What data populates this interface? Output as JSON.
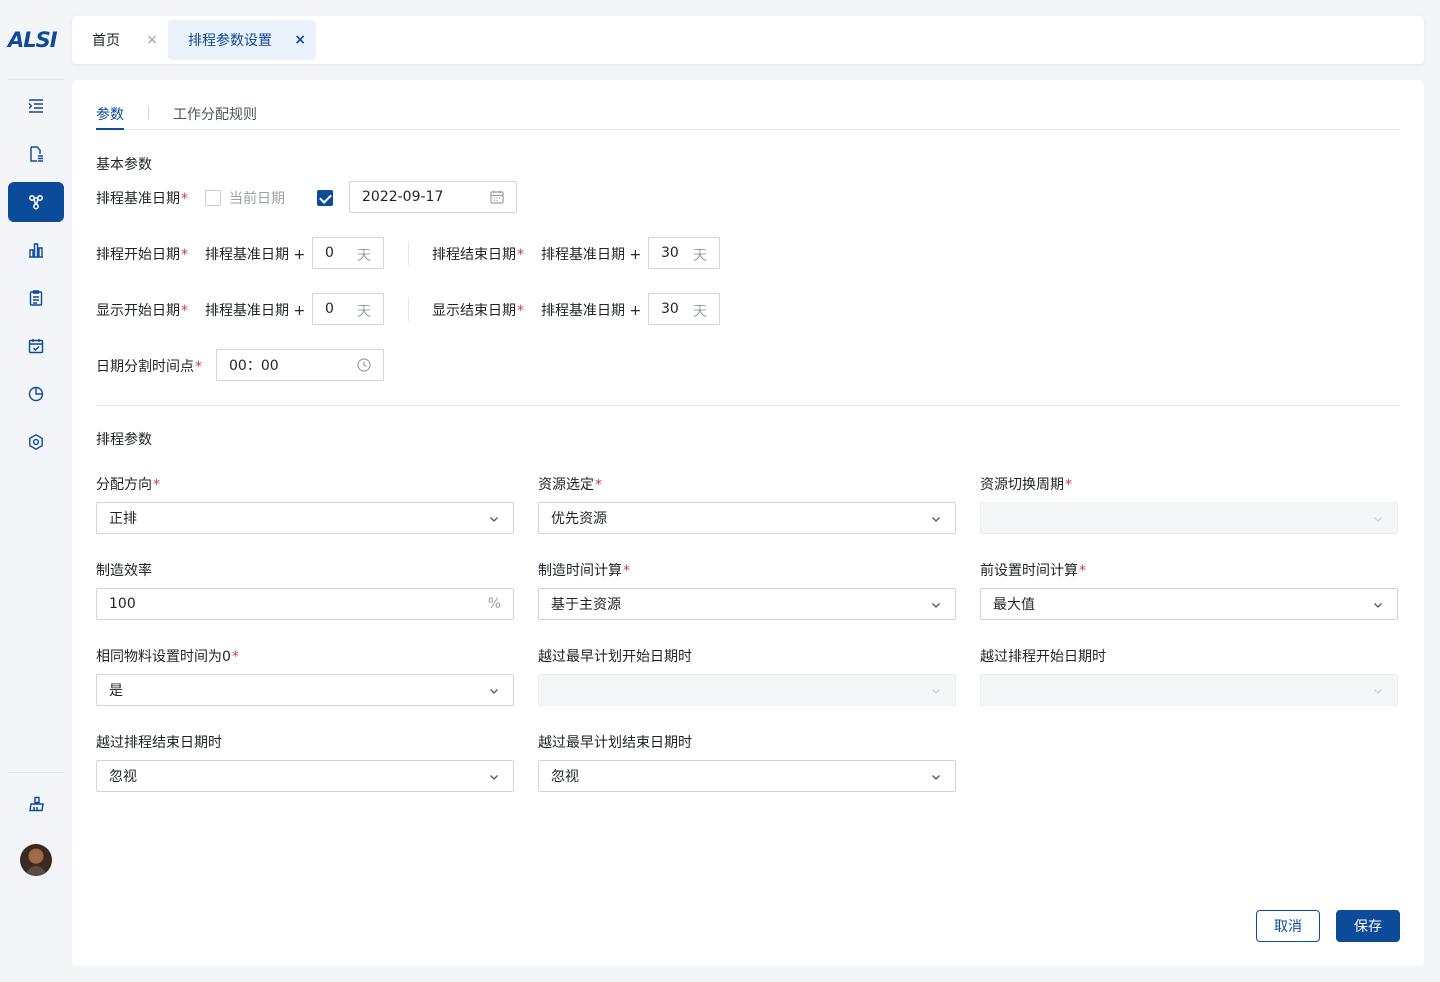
{
  "brand": {
    "logo_text": "ALSI",
    "accent_color": "#0c4a9a"
  },
  "sidebar": {
    "items": [
      {
        "icon": "menu-indent-icon"
      },
      {
        "icon": "document-list-icon"
      },
      {
        "icon": "schedule-flow-icon",
        "active": true
      },
      {
        "icon": "bar-chart-icon"
      },
      {
        "icon": "clipboard-icon"
      },
      {
        "icon": "calendar-check-icon"
      },
      {
        "icon": "pie-chart-icon"
      },
      {
        "icon": "settings-hexagon-icon"
      }
    ],
    "bottom": [
      {
        "icon": "clean-icon"
      },
      {
        "icon": "user-avatar"
      }
    ]
  },
  "page_tabs": [
    {
      "label": "首页",
      "close": "×"
    },
    {
      "label": "排程参数设置",
      "close": "×",
      "active": true
    }
  ],
  "sub_tabs": {
    "params": "参数",
    "rules": "工作分配规则"
  },
  "basic": {
    "title": "基本参数",
    "base_date_label": "排程基准日期",
    "current_date_label": "当前日期",
    "current_date_checked": false,
    "custom_date_checked": true,
    "date_value": "2022-09-17",
    "sched_start_label": "排程开始日期",
    "sched_start_prefix": "排程基准日期 +",
    "sched_start_value": "0",
    "sched_end_label": "排程结束日期",
    "sched_end_prefix": "排程基准日期 +",
    "sched_end_value": "30",
    "disp_start_label": "显示开始日期",
    "disp_start_prefix": "排程基准日期 +",
    "disp_start_value": "0",
    "disp_end_label": "显示结束日期",
    "disp_end_prefix": "排程基准日期 +",
    "disp_end_value": "30",
    "day_unit": "天",
    "split_time_label": "日期分割时间点",
    "split_time_value": "00：00",
    "required_mark": "*"
  },
  "sched": {
    "title": "排程参数",
    "fields": {
      "direction": {
        "label": "分配方向",
        "value": "正排",
        "required": true
      },
      "resource_select": {
        "label": "资源选定",
        "value": "优先资源",
        "required": true
      },
      "resource_switch": {
        "label": "资源切换周期",
        "value": "",
        "required": true,
        "disabled": true
      },
      "efficiency": {
        "label": "制造效率",
        "value": "100",
        "suffix": "%"
      },
      "mfg_time": {
        "label": "制造时间计算",
        "value": "基于主资源",
        "required": true
      },
      "pre_setup": {
        "label": "前设置时间计算",
        "value": "最大值",
        "required": true
      },
      "same_material": {
        "label": "相同物料设置时间为0",
        "value": "是",
        "required": true
      },
      "over_earliest_start": {
        "label": "越过最早计划开始日期时",
        "value": "",
        "disabled": true
      },
      "over_sched_start": {
        "label": "越过排程开始日期时",
        "value": "",
        "disabled": true
      },
      "over_sched_end": {
        "label": "越过排程结束日期时",
        "value": "忽视"
      },
      "over_earliest_end": {
        "label": "越过最早计划结束日期时",
        "value": "忽视"
      }
    }
  },
  "actions": {
    "cancel": "取消",
    "save": "保存"
  }
}
